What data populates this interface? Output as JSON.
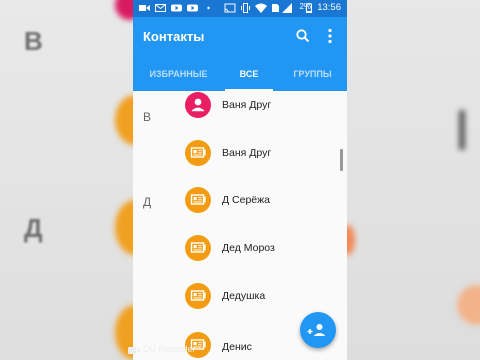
{
  "background": {
    "letters": [
      "В",
      "Д"
    ]
  },
  "statusbar": {
    "battery_percent": "2%",
    "time": "13:56"
  },
  "appbar": {
    "title": "Контакты",
    "search_icon": "search-icon",
    "overflow_icon": "more-vert-icon"
  },
  "tabs": [
    {
      "label": "ИЗБРАННЫЕ",
      "active": false
    },
    {
      "label": "ВСЕ",
      "active": true
    },
    {
      "label": "ГРУППЫ",
      "active": false
    }
  ],
  "contacts": {
    "sections": [
      {
        "letter": "В",
        "items": [
          {
            "name": "Ваня Друг",
            "avatar": "person-icon",
            "color": "#e91e63"
          },
          {
            "name": "Ваня Друг",
            "avatar": "contact-card-icon",
            "color": "#f39c12"
          }
        ]
      },
      {
        "letter": "Д",
        "items": [
          {
            "name": "Д Серёжа",
            "avatar": "contact-card-icon",
            "color": "#f39c12"
          },
          {
            "name": "Дед Мороз",
            "avatar": "contact-card-icon",
            "color": "#f39c12"
          },
          {
            "name": "Дедушка",
            "avatar": "contact-card-icon",
            "color": "#f39c12"
          },
          {
            "name": "Денис",
            "avatar": "contact-card-icon",
            "color": "#f39c12"
          }
        ]
      }
    ]
  },
  "fab": {
    "icon": "add-person-icon"
  },
  "watermark": {
    "text": "DU Recorder"
  },
  "colors": {
    "primary": "#2196f3",
    "primary_dark": "#1976d2",
    "accent_pink": "#e91e63",
    "contact_orange": "#f39c12"
  }
}
